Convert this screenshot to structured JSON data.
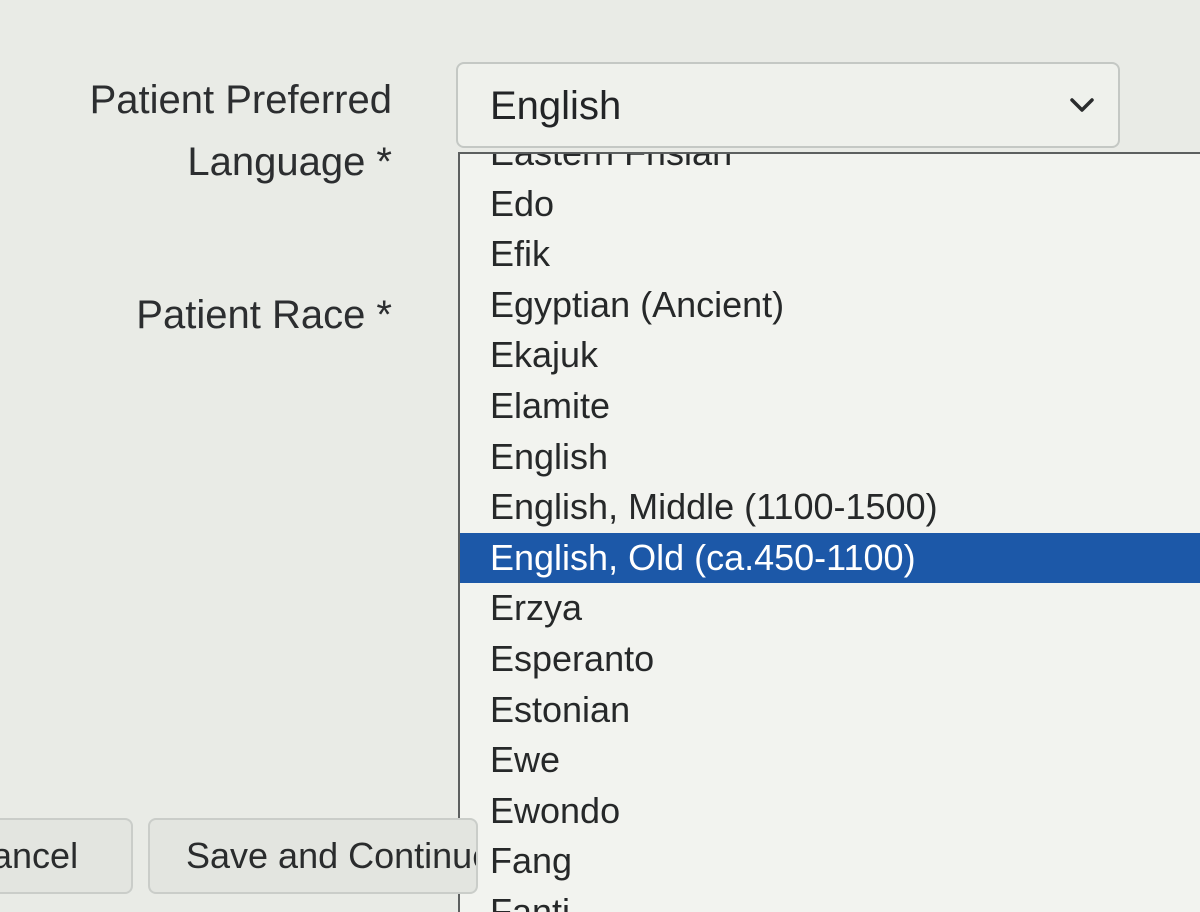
{
  "form": {
    "language_label_line1": "Patient Preferred",
    "language_label_line2": "Language *",
    "race_label": "Patient Race *",
    "language_select": {
      "selected_value": "English",
      "icon": "chevron-down-icon"
    }
  },
  "dropdown": {
    "options": [
      "Eastern Frisian",
      "Edo",
      "Efik",
      "Egyptian (Ancient)",
      "Ekajuk",
      "Elamite",
      "English",
      "English, Middle (1100-1500)",
      "English, Old (ca.450-1100)",
      "Erzya",
      "Esperanto",
      "Estonian",
      "Ewe",
      "Ewondo",
      "Fang",
      "Fanti"
    ],
    "highlighted_option": "English, Old (ca.450-1100)",
    "highlight_color": "#1c58a8"
  },
  "buttons": {
    "cancel_label": "Cancel",
    "save_label": "Save and Continue"
  }
}
